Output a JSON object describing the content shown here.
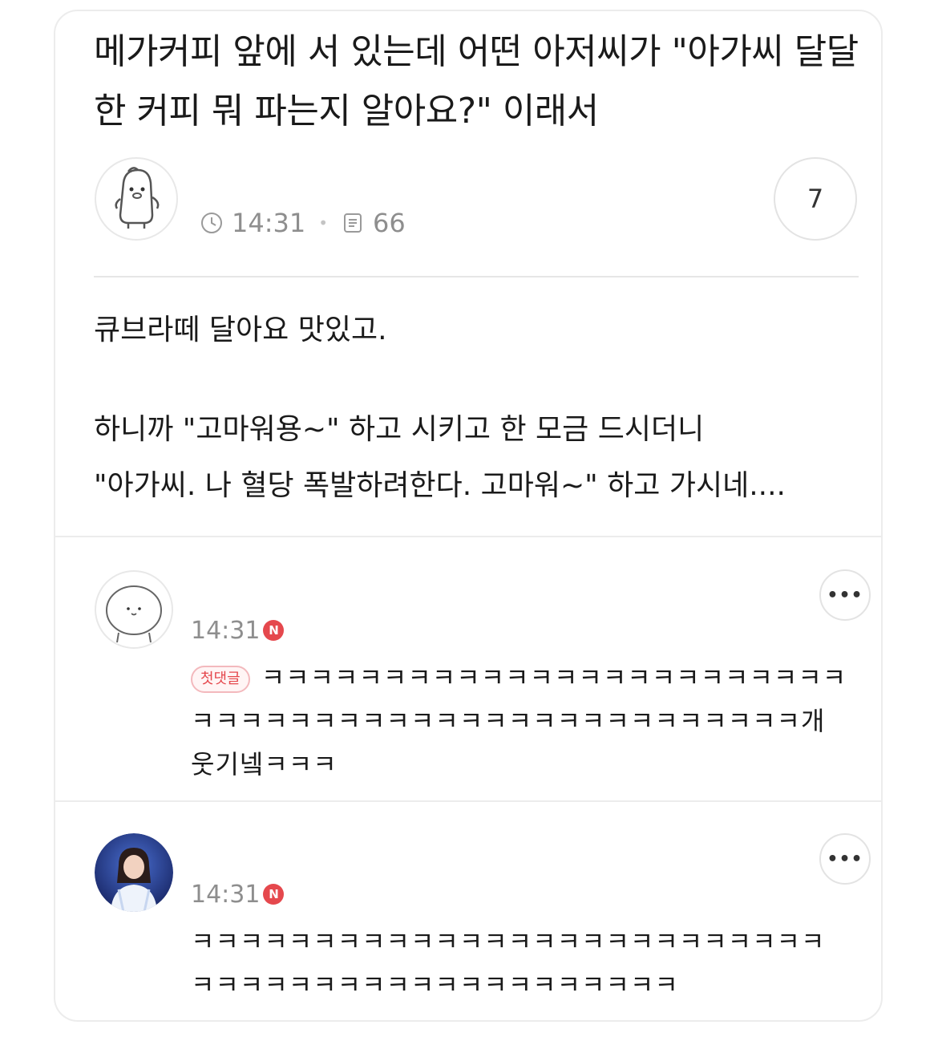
{
  "post": {
    "title": "메가커피 앞에 서 있는데 어떤 아저씨가 \"아가씨 달달한 커피 뭐 파는지 알아요?\" 이래서",
    "time": "14:31",
    "views": "66",
    "comment_count": "7",
    "body": [
      "큐브라떼 달아요 맛있고.",
      "하니까 \"고마워용~\" 하고 시키고 한 모금 드시더니",
      "\"아가씨. 나 혈당 폭발하려한다. 고마워~\" 하고 가시네...."
    ]
  },
  "comments": [
    {
      "time": "14:31",
      "new_badge": "N",
      "first_comment_badge": "첫댓글",
      "text": "ㅋㅋㅋㅋㅋㅋㅋㅋㅋㅋㅋㅋㅋㅋㅋㅋㅋㅋㅋㅋㅋㅋㅋㅋㅋㅋㅋㅋㅋㅋㅋㅋㅋㅋㅋㅋㅋㅋㅋㅋㅋㅋㅋㅋㅋㅋㅋㅋㅋ개웃기넼ㅋㅋㅋ",
      "more": "•••"
    },
    {
      "time": "14:31",
      "new_badge": "N",
      "text": "ㅋㅋㅋㅋㅋㅋㅋㅋㅋㅋㅋㅋㅋㅋㅋㅋㅋㅋㅋㅋㅋㅋㅋㅋㅋㅋㅋㅋㅋㅋㅋㅋㅋㅋㅋㅋㅋㅋㅋㅋㅋㅋㅋㅋㅋㅋ",
      "more": "•••"
    }
  ],
  "icons": {
    "time": "clock-icon",
    "views": "document-icon",
    "author_avatar": "penguin-character-avatar",
    "comment1_avatar": "round-character-avatar",
    "comment2_avatar": "photo-avatar"
  },
  "colors": {
    "badge_red": "#e5484d",
    "meta_gray": "#8e8e8e",
    "divider": "#e6e6e6"
  }
}
